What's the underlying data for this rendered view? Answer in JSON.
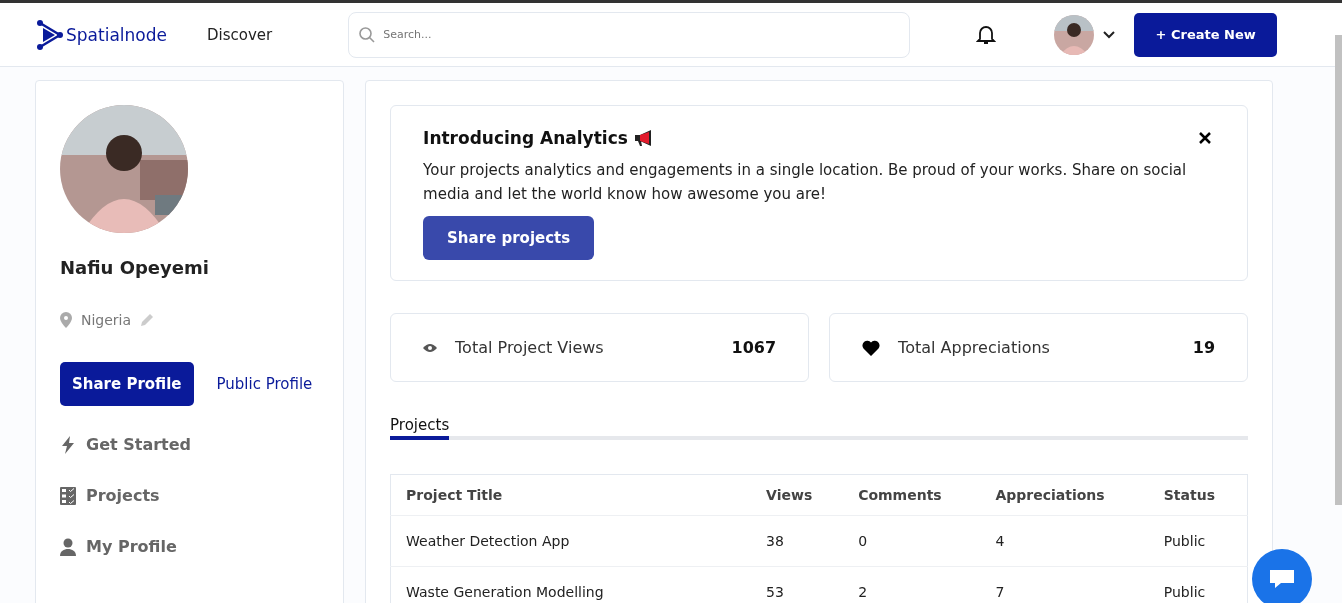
{
  "header": {
    "logo": "Spatialnode",
    "nav": "Discover",
    "search": {
      "placeholder": "Search..."
    },
    "create_button": "+ Create New"
  },
  "profile": {
    "name": "Nafiu Opeyemi",
    "location": "Nigeria",
    "share_button": "Share Profile",
    "public_link": "Public Profile",
    "menu": [
      {
        "label": "Get Started",
        "kind": "bolt"
      },
      {
        "label": "Projects",
        "kind": "grid"
      },
      {
        "label": "My Profile",
        "kind": "person"
      }
    ]
  },
  "banner": {
    "title": "Introducing Analytics",
    "text": "Your projects analytics and engagements in a single location. Be proud of your works. Share on social media and let the world know how awesome you are!",
    "button": "Share projects"
  },
  "stats": [
    {
      "label": "Total Project Views",
      "value": "1067",
      "kind": "eye"
    },
    {
      "label": "Total Appreciations",
      "value": "19",
      "kind": "heart"
    }
  ],
  "tabs": [
    {
      "label": "Projects",
      "selected": true
    }
  ],
  "table": {
    "columns": [
      "Project Title",
      "Views",
      "Comments",
      "Appreciations",
      "Status"
    ],
    "rows": [
      [
        "Weather Detection App",
        "38",
        "0",
        "4",
        "Public"
      ],
      [
        "Waste Generation Modelling",
        "53",
        "2",
        "7",
        "Public"
      ]
    ]
  }
}
